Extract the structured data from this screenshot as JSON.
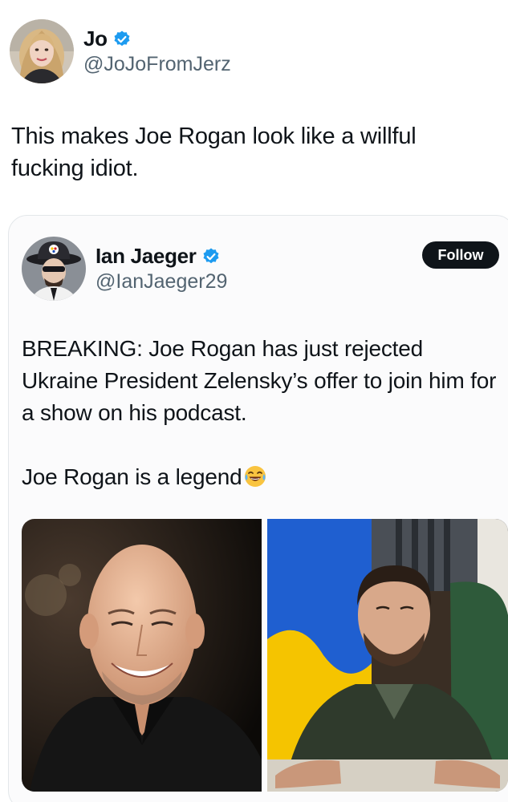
{
  "tweet": {
    "author": {
      "display_name": "Jo",
      "handle": "@JoJoFromJerz",
      "verified": true,
      "avatar_icon": "profile-photo-woman"
    },
    "text": "This makes Joe Rogan look like a willful fucking idiot."
  },
  "quoted_tweet": {
    "author": {
      "display_name": "Ian Jaeger",
      "handle": "@IanJaeger29",
      "verified": true,
      "avatar_icon": "profile-illustration-hat-sunglasses"
    },
    "follow_label": "Follow",
    "text_line1": "BREAKING: Joe Rogan has just rejected Ukraine President Zelensky’s offer to join him for a show on his podcast.",
    "text_line2": "Joe Rogan is a legend",
    "emoji": "face-with-tears-of-joy",
    "media": [
      {
        "icon": "photo-bald-man-smiling"
      },
      {
        "icon": "photo-man-in-front-of-flag"
      }
    ]
  },
  "colors": {
    "verified_blue": "#1d9bf0",
    "text_primary": "#0f1419",
    "text_secondary": "#536471",
    "follow_bg": "#0f1419",
    "flag_blue": "#1f5fd0",
    "flag_yellow": "#f5c400"
  }
}
